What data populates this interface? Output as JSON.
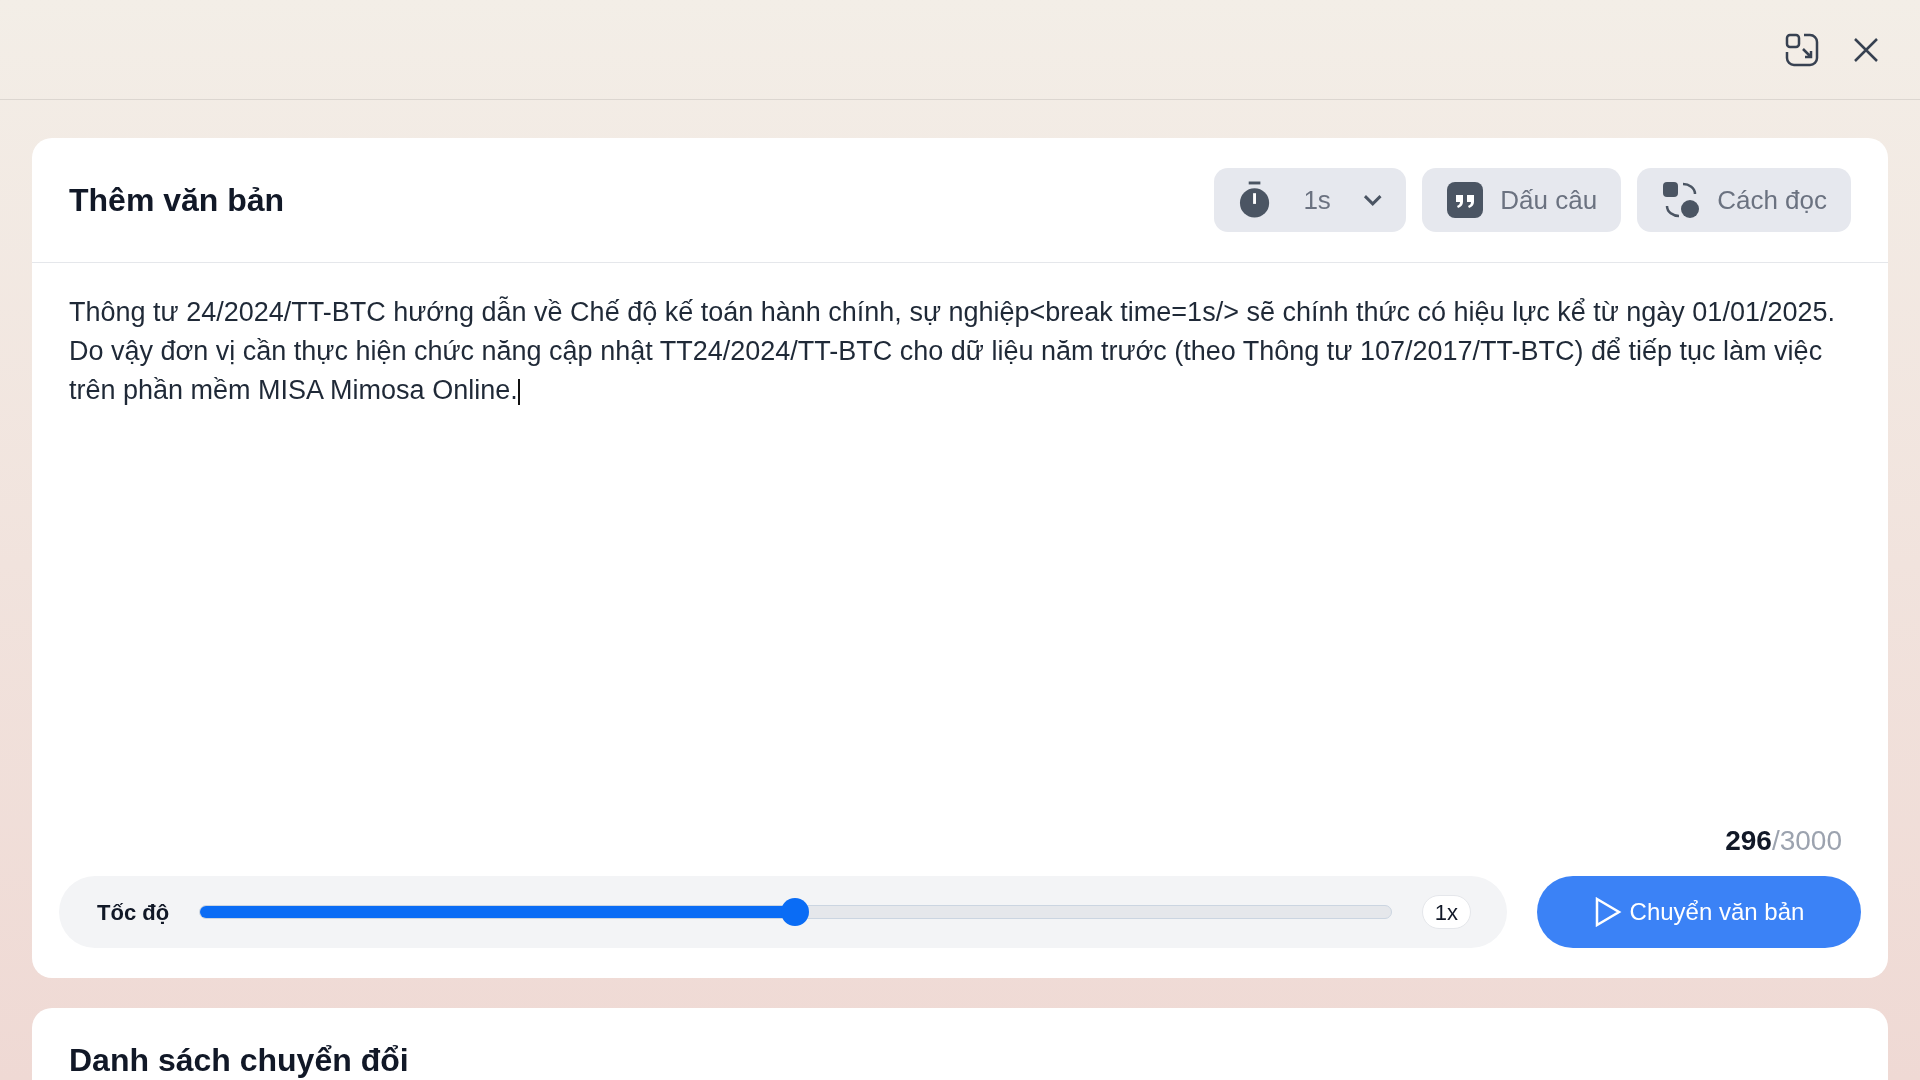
{
  "editor": {
    "title": "Thêm văn bản",
    "pause": {
      "value": "1s"
    },
    "buttons": [
      {
        "label": "Dấu câu",
        "kind": "quote"
      },
      {
        "label": "Cách đọc",
        "kind": "translate"
      }
    ],
    "text": "Thông tư 24/2024/TT-BTC hướng dẫn về Chế độ kế toán hành chính, sự nghiệp<break time=1s/> sẽ chính thức có hiệu lực kể từ ngày 01/01/2025. Do vậy đơn vị cần thực hiện chức năng cập nhật TT24/2024/TT-BTC cho dữ liệu năm trước (theo Thông tư 107/2017/TT-BTC) để tiếp tục làm việc trên phần mềm MISA Mimosa Online.",
    "count": "296",
    "limit": "/3000",
    "speed": {
      "label": "Tốc độ",
      "level": 0.5,
      "reading": "1x"
    },
    "convert_button": "Chuyển văn bản"
  },
  "list": {
    "title": "Danh sách chuyển đổi"
  }
}
